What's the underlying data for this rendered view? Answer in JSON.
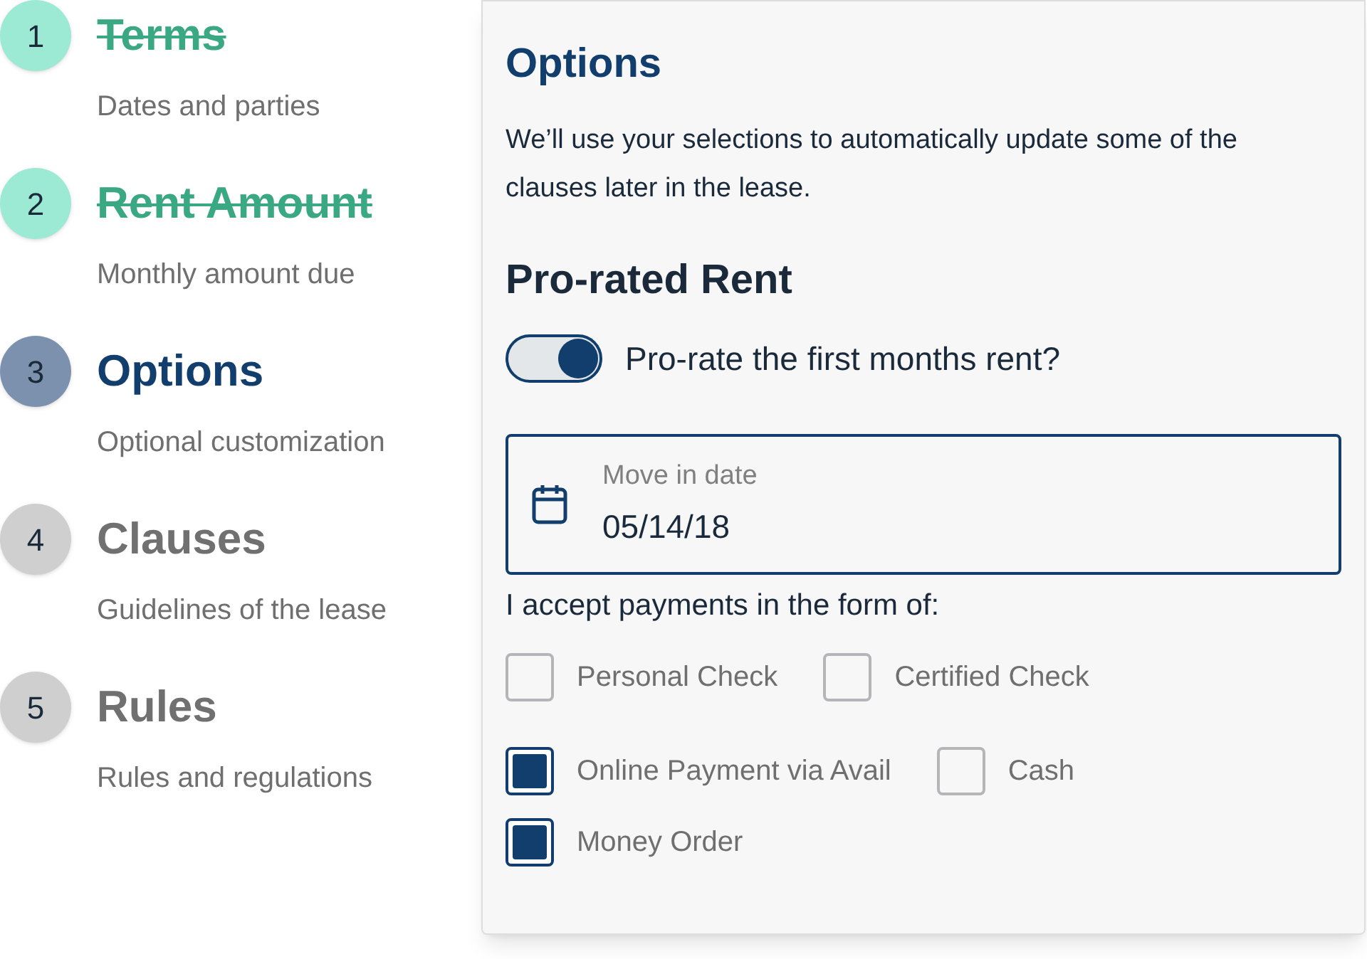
{
  "steps": [
    {
      "number": "1",
      "title": "Terms",
      "subtitle": "Dates and parties",
      "completed": true,
      "selected": false
    },
    {
      "number": "2",
      "title": "Rent Amount",
      "subtitle": "Monthly amount due",
      "completed": true,
      "selected": false
    },
    {
      "number": "3",
      "title": "Options",
      "subtitle": "Optional customization",
      "completed": false,
      "selected": true
    },
    {
      "number": "4",
      "title": "Clauses",
      "subtitle": "Guidelines of the lease",
      "completed": false,
      "selected": false
    },
    {
      "number": "5",
      "title": "Rules",
      "subtitle": "Rules and regulations",
      "completed": false,
      "selected": false
    }
  ],
  "panel": {
    "title": "Options",
    "description": "We’ll use your selections to automatically update some of the clauses later in the lease.",
    "section_title": "Pro-rated Rent",
    "toggle": {
      "label": "Pro-rate the first months rent?",
      "on": true
    },
    "date_field": {
      "label": "Move in date",
      "value": "05/14/18"
    },
    "payments": {
      "label": "I accept payments in the form of:",
      "rows": [
        [
          {
            "label": "Personal Check",
            "checked": false
          },
          {
            "label": "Certified Check",
            "checked": false
          }
        ],
        [
          {
            "label": "Online Payment via Avail",
            "checked": true
          },
          {
            "label": "Cash",
            "checked": false
          }
        ],
        [
          {
            "label": "Money Order",
            "checked": true
          }
        ]
      ]
    }
  }
}
